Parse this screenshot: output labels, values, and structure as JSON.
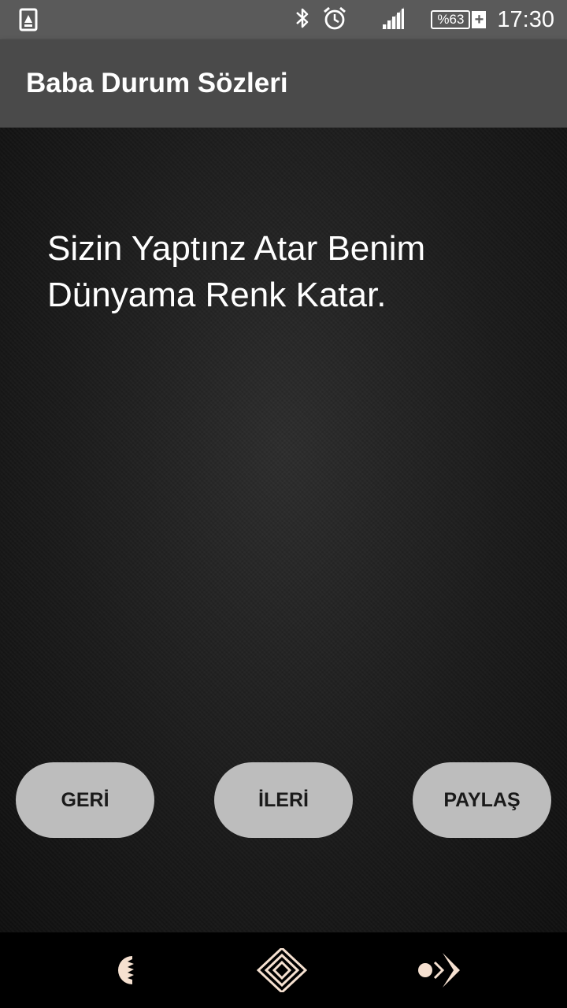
{
  "status_bar": {
    "time": "17:30",
    "battery_level": "%63",
    "battery_charging_symbol": "+",
    "icons": [
      "download-notification-icon",
      "bluetooth-icon",
      "alarm-icon",
      "signal-icon",
      "battery-icon"
    ]
  },
  "app_bar": {
    "title": "Baba Durum Sözleri"
  },
  "main": {
    "quote": "Sizin Yaptınz Atar Benim Dünyama Renk Katar."
  },
  "buttons": {
    "back_label": "GERİ",
    "next_label": "İLERİ",
    "share_label": "PAYLAŞ",
    "color": "#bdbdbd"
  },
  "nav_bar": {
    "icons": [
      "back-icon",
      "home-icon",
      "recents-icon"
    ]
  },
  "colors": {
    "status_bar": "#5a5a5a",
    "app_bar": "#4a4a4a",
    "nav_icon": "#f5e0d0"
  }
}
